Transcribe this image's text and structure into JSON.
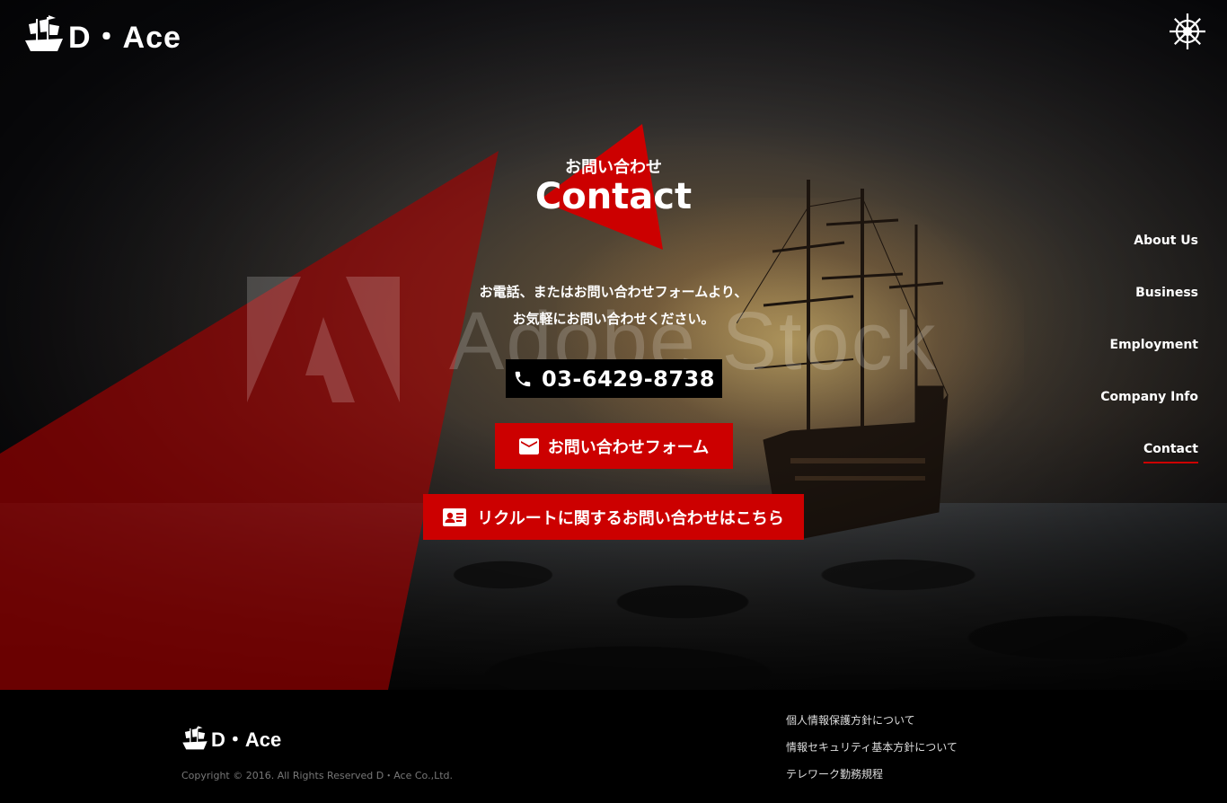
{
  "brand": {
    "name": "D・Ace",
    "accent_color": "#cc0000"
  },
  "header": {
    "logo_text": "D・Ace",
    "menu_icon": "ship-wheel-icon"
  },
  "section": {
    "title_jp": "お問い合わせ",
    "title_en": "Contact"
  },
  "description": {
    "line1": "お電話、またはお問い合わせフォームより、",
    "line2": "お気軽にお問い合わせください。"
  },
  "watermark": {
    "text": "Adobe Stock"
  },
  "buttons": {
    "phone": {
      "icon": "phone-icon",
      "label": "03-6429-8738"
    },
    "form": {
      "icon": "mail-icon",
      "label": "お問い合わせフォーム"
    },
    "recruit": {
      "icon": "contact-card-icon",
      "label": "リクルートに関するお問い合わせはこちら"
    }
  },
  "side_nav": {
    "items": [
      {
        "label": "About Us"
      },
      {
        "label": "Business"
      },
      {
        "label": "Employment"
      },
      {
        "label": "Company Info"
      },
      {
        "label": "Contact",
        "active": true
      }
    ]
  },
  "footer": {
    "logo_text": "D・Ace",
    "copyright": "Copyright © 2016. All Rights Reserved D・Ace Co.,Ltd.",
    "links": [
      {
        "label": "個人情報保護方針について"
      },
      {
        "label": "情報セキュリティ基本方針について"
      },
      {
        "label": "テレワーク勤務規程"
      }
    ]
  }
}
